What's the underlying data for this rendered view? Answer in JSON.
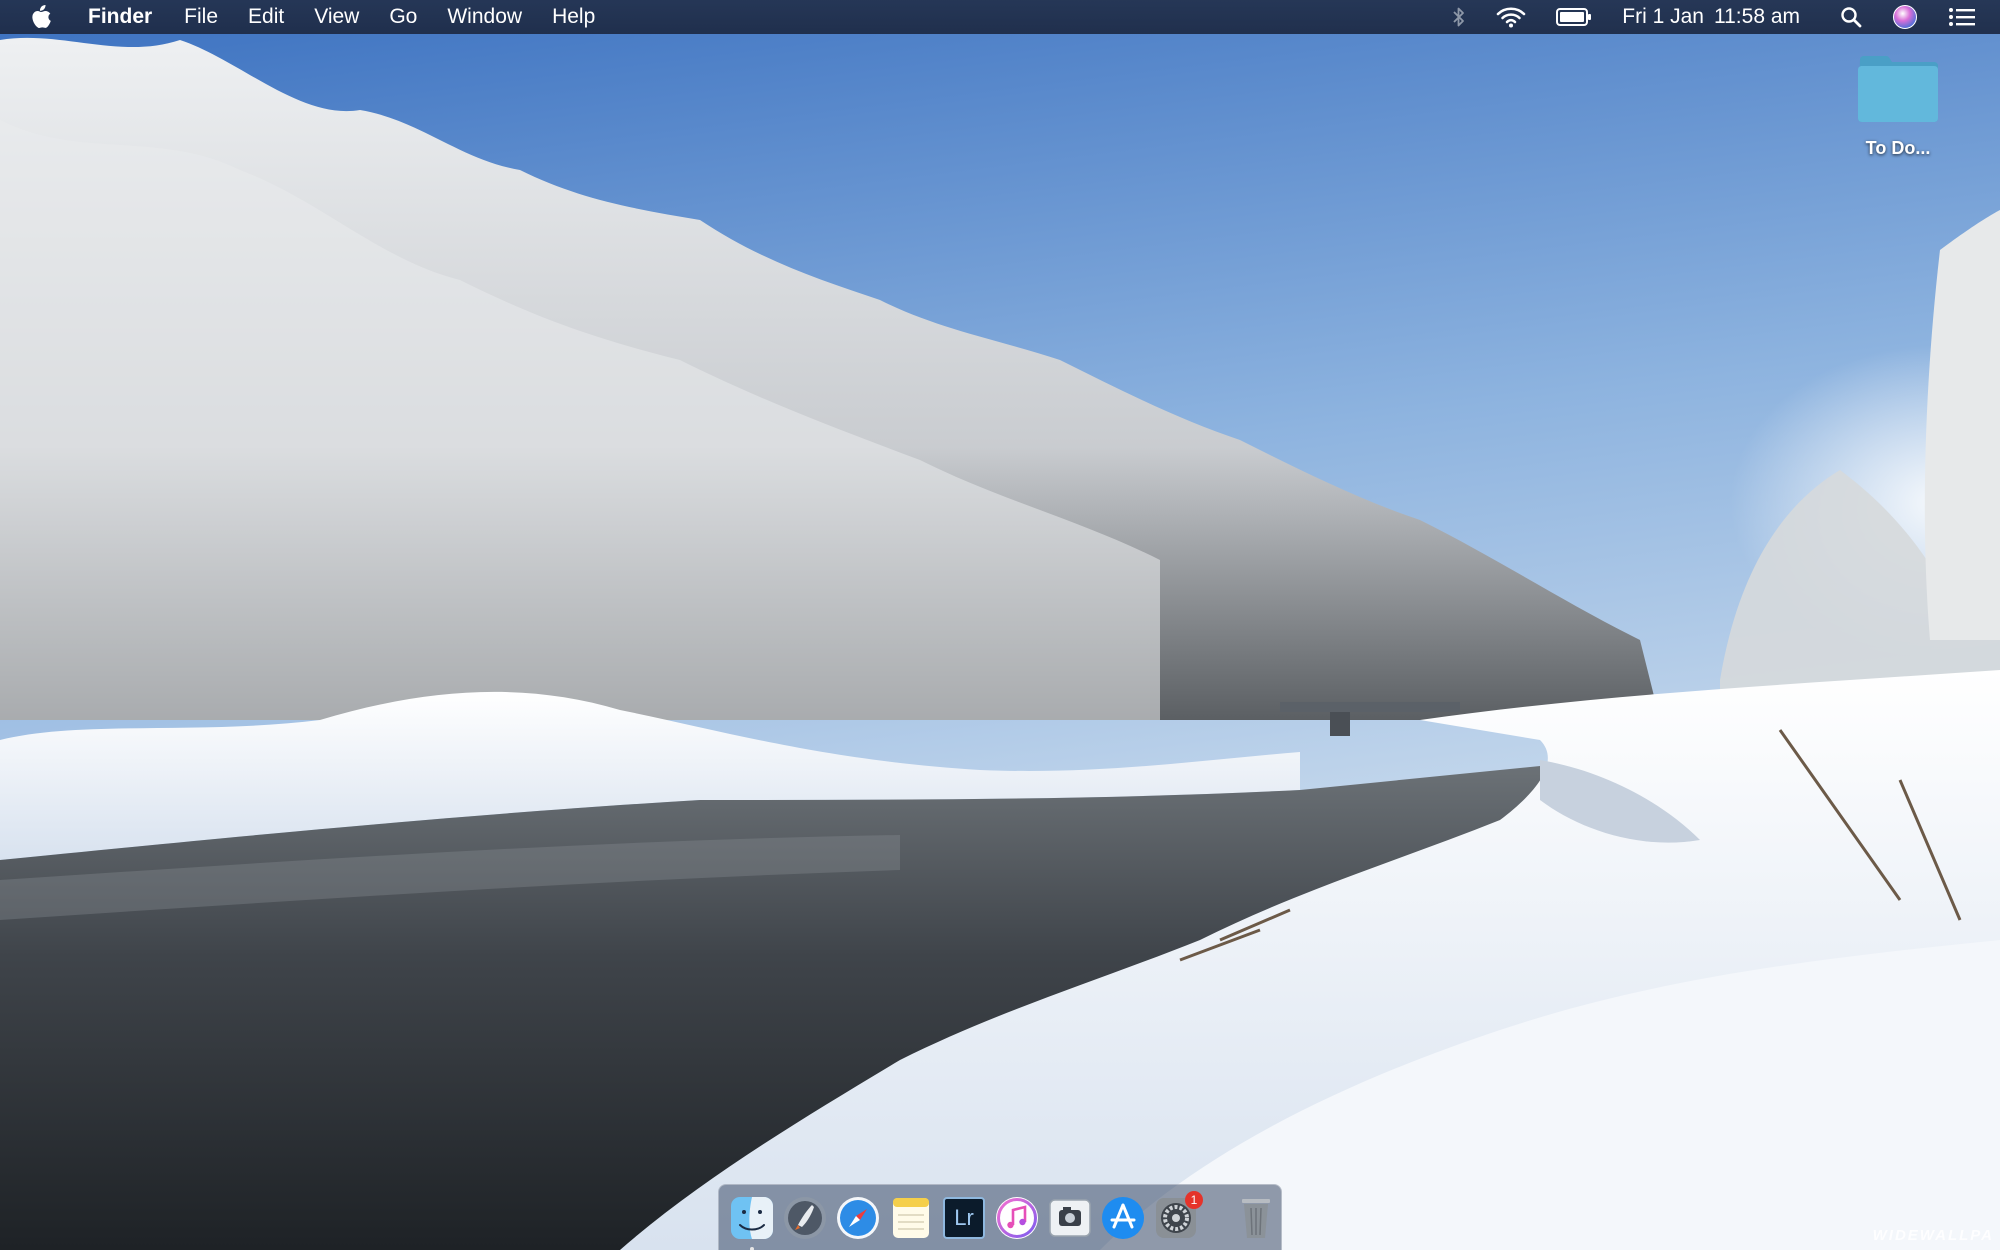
{
  "menubar": {
    "apple_icon": "apple-icon",
    "app_name": "Finder",
    "menus": [
      "File",
      "Edit",
      "View",
      "Go",
      "Window",
      "Help"
    ],
    "status_icons": [
      "bluetooth-icon",
      "wifi-icon",
      "battery-icon"
    ],
    "clock": {
      "day": "Fri 1 Jan",
      "time": "11:58 am"
    },
    "right_icons": [
      "spotlight-search-icon",
      "siri-icon",
      "notification-center-icon"
    ]
  },
  "desktop": {
    "folder": {
      "label": "To Do...",
      "icon": "folder-icon"
    }
  },
  "dock": {
    "apps": [
      {
        "name": "Finder",
        "icon": "finder-icon",
        "running": true
      },
      {
        "name": "Launchpad",
        "icon": "launchpad-icon"
      },
      {
        "name": "Safari",
        "icon": "safari-icon"
      },
      {
        "name": "Notes",
        "icon": "notes-icon"
      },
      {
        "name": "Lightroom",
        "icon": "lightroom-icon",
        "text": "Lr"
      },
      {
        "name": "iTunes",
        "icon": "itunes-icon"
      },
      {
        "name": "Screenshot",
        "icon": "screenshot-icon"
      },
      {
        "name": "App Store",
        "icon": "app-store-icon"
      },
      {
        "name": "System Preferences",
        "icon": "system-preferences-icon",
        "badge": "1"
      }
    ],
    "trash": {
      "icon": "trash-icon"
    }
  },
  "wallpaper": {
    "watermark": "WIDEWALLPA"
  },
  "colors": {
    "menubar": "#23345a",
    "sky_top": "#3f78c8",
    "sky_bottom": "#dfe9f2",
    "folder": "#5fb6d8",
    "badge": "#e5332a"
  }
}
